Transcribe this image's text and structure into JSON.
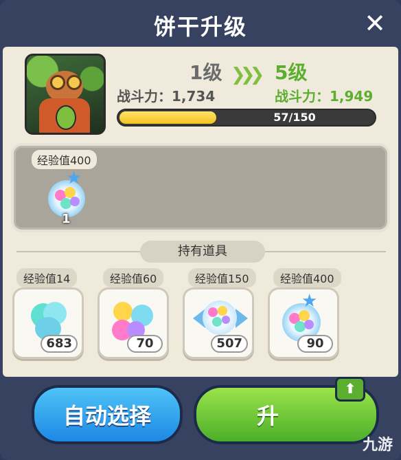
{
  "header": {
    "title": "饼干升级",
    "close_icon": "close-icon"
  },
  "cookie": {
    "current_level": "1级",
    "current_power": "战斗力：1,734",
    "next_level": "5级",
    "next_power": "战斗力：1,949",
    "xp_text": "57/150",
    "xp_fraction": 0.38
  },
  "selected": {
    "label": "经验值400",
    "count": "1",
    "icon": "star-jelly-pack-icon"
  },
  "owned_title": "持有道具",
  "items": [
    {
      "label": "经验值14",
      "count": "683",
      "icon": "blue-jelly-icon"
    },
    {
      "label": "经验值60",
      "count": "70",
      "icon": "rainbow-jelly-icon"
    },
    {
      "label": "经验值150",
      "count": "507",
      "icon": "candy-wrap-jelly-icon"
    },
    {
      "label": "经验值400",
      "count": "90",
      "icon": "star-jelly-pack-icon"
    }
  ],
  "buttons": {
    "auto": "自动选择",
    "upgrade": "升"
  },
  "watermark": "九游",
  "colors": {
    "accent_green": "#5cae2f",
    "panel": "#36425f",
    "button_blue": "#1e88e5"
  }
}
